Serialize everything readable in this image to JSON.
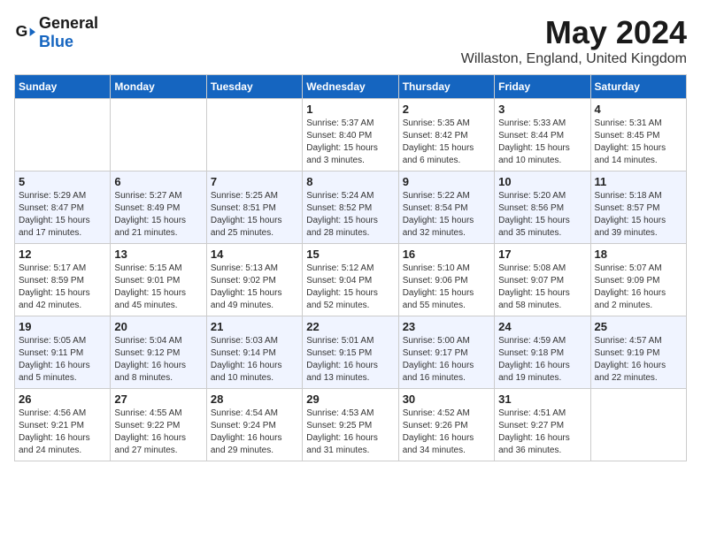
{
  "header": {
    "logo_general": "General",
    "logo_blue": "Blue",
    "title": "May 2024",
    "location": "Willaston, England, United Kingdom"
  },
  "days_of_week": [
    "Sunday",
    "Monday",
    "Tuesday",
    "Wednesday",
    "Thursday",
    "Friday",
    "Saturday"
  ],
  "weeks": [
    [
      {
        "day": "",
        "detail": ""
      },
      {
        "day": "",
        "detail": ""
      },
      {
        "day": "",
        "detail": ""
      },
      {
        "day": "1",
        "detail": "Sunrise: 5:37 AM\nSunset: 8:40 PM\nDaylight: 15 hours\nand 3 minutes."
      },
      {
        "day": "2",
        "detail": "Sunrise: 5:35 AM\nSunset: 8:42 PM\nDaylight: 15 hours\nand 6 minutes."
      },
      {
        "day": "3",
        "detail": "Sunrise: 5:33 AM\nSunset: 8:44 PM\nDaylight: 15 hours\nand 10 minutes."
      },
      {
        "day": "4",
        "detail": "Sunrise: 5:31 AM\nSunset: 8:45 PM\nDaylight: 15 hours\nand 14 minutes."
      }
    ],
    [
      {
        "day": "5",
        "detail": "Sunrise: 5:29 AM\nSunset: 8:47 PM\nDaylight: 15 hours\nand 17 minutes."
      },
      {
        "day": "6",
        "detail": "Sunrise: 5:27 AM\nSunset: 8:49 PM\nDaylight: 15 hours\nand 21 minutes."
      },
      {
        "day": "7",
        "detail": "Sunrise: 5:25 AM\nSunset: 8:51 PM\nDaylight: 15 hours\nand 25 minutes."
      },
      {
        "day": "8",
        "detail": "Sunrise: 5:24 AM\nSunset: 8:52 PM\nDaylight: 15 hours\nand 28 minutes."
      },
      {
        "day": "9",
        "detail": "Sunrise: 5:22 AM\nSunset: 8:54 PM\nDaylight: 15 hours\nand 32 minutes."
      },
      {
        "day": "10",
        "detail": "Sunrise: 5:20 AM\nSunset: 8:56 PM\nDaylight: 15 hours\nand 35 minutes."
      },
      {
        "day": "11",
        "detail": "Sunrise: 5:18 AM\nSunset: 8:57 PM\nDaylight: 15 hours\nand 39 minutes."
      }
    ],
    [
      {
        "day": "12",
        "detail": "Sunrise: 5:17 AM\nSunset: 8:59 PM\nDaylight: 15 hours\nand 42 minutes."
      },
      {
        "day": "13",
        "detail": "Sunrise: 5:15 AM\nSunset: 9:01 PM\nDaylight: 15 hours\nand 45 minutes."
      },
      {
        "day": "14",
        "detail": "Sunrise: 5:13 AM\nSunset: 9:02 PM\nDaylight: 15 hours\nand 49 minutes."
      },
      {
        "day": "15",
        "detail": "Sunrise: 5:12 AM\nSunset: 9:04 PM\nDaylight: 15 hours\nand 52 minutes."
      },
      {
        "day": "16",
        "detail": "Sunrise: 5:10 AM\nSunset: 9:06 PM\nDaylight: 15 hours\nand 55 minutes."
      },
      {
        "day": "17",
        "detail": "Sunrise: 5:08 AM\nSunset: 9:07 PM\nDaylight: 15 hours\nand 58 minutes."
      },
      {
        "day": "18",
        "detail": "Sunrise: 5:07 AM\nSunset: 9:09 PM\nDaylight: 16 hours\nand 2 minutes."
      }
    ],
    [
      {
        "day": "19",
        "detail": "Sunrise: 5:05 AM\nSunset: 9:11 PM\nDaylight: 16 hours\nand 5 minutes."
      },
      {
        "day": "20",
        "detail": "Sunrise: 5:04 AM\nSunset: 9:12 PM\nDaylight: 16 hours\nand 8 minutes."
      },
      {
        "day": "21",
        "detail": "Sunrise: 5:03 AM\nSunset: 9:14 PM\nDaylight: 16 hours\nand 10 minutes."
      },
      {
        "day": "22",
        "detail": "Sunrise: 5:01 AM\nSunset: 9:15 PM\nDaylight: 16 hours\nand 13 minutes."
      },
      {
        "day": "23",
        "detail": "Sunrise: 5:00 AM\nSunset: 9:17 PM\nDaylight: 16 hours\nand 16 minutes."
      },
      {
        "day": "24",
        "detail": "Sunrise: 4:59 AM\nSunset: 9:18 PM\nDaylight: 16 hours\nand 19 minutes."
      },
      {
        "day": "25",
        "detail": "Sunrise: 4:57 AM\nSunset: 9:19 PM\nDaylight: 16 hours\nand 22 minutes."
      }
    ],
    [
      {
        "day": "26",
        "detail": "Sunrise: 4:56 AM\nSunset: 9:21 PM\nDaylight: 16 hours\nand 24 minutes."
      },
      {
        "day": "27",
        "detail": "Sunrise: 4:55 AM\nSunset: 9:22 PM\nDaylight: 16 hours\nand 27 minutes."
      },
      {
        "day": "28",
        "detail": "Sunrise: 4:54 AM\nSunset: 9:24 PM\nDaylight: 16 hours\nand 29 minutes."
      },
      {
        "day": "29",
        "detail": "Sunrise: 4:53 AM\nSunset: 9:25 PM\nDaylight: 16 hours\nand 31 minutes."
      },
      {
        "day": "30",
        "detail": "Sunrise: 4:52 AM\nSunset: 9:26 PM\nDaylight: 16 hours\nand 34 minutes."
      },
      {
        "day": "31",
        "detail": "Sunrise: 4:51 AM\nSunset: 9:27 PM\nDaylight: 16 hours\nand 36 minutes."
      },
      {
        "day": "",
        "detail": ""
      }
    ]
  ]
}
